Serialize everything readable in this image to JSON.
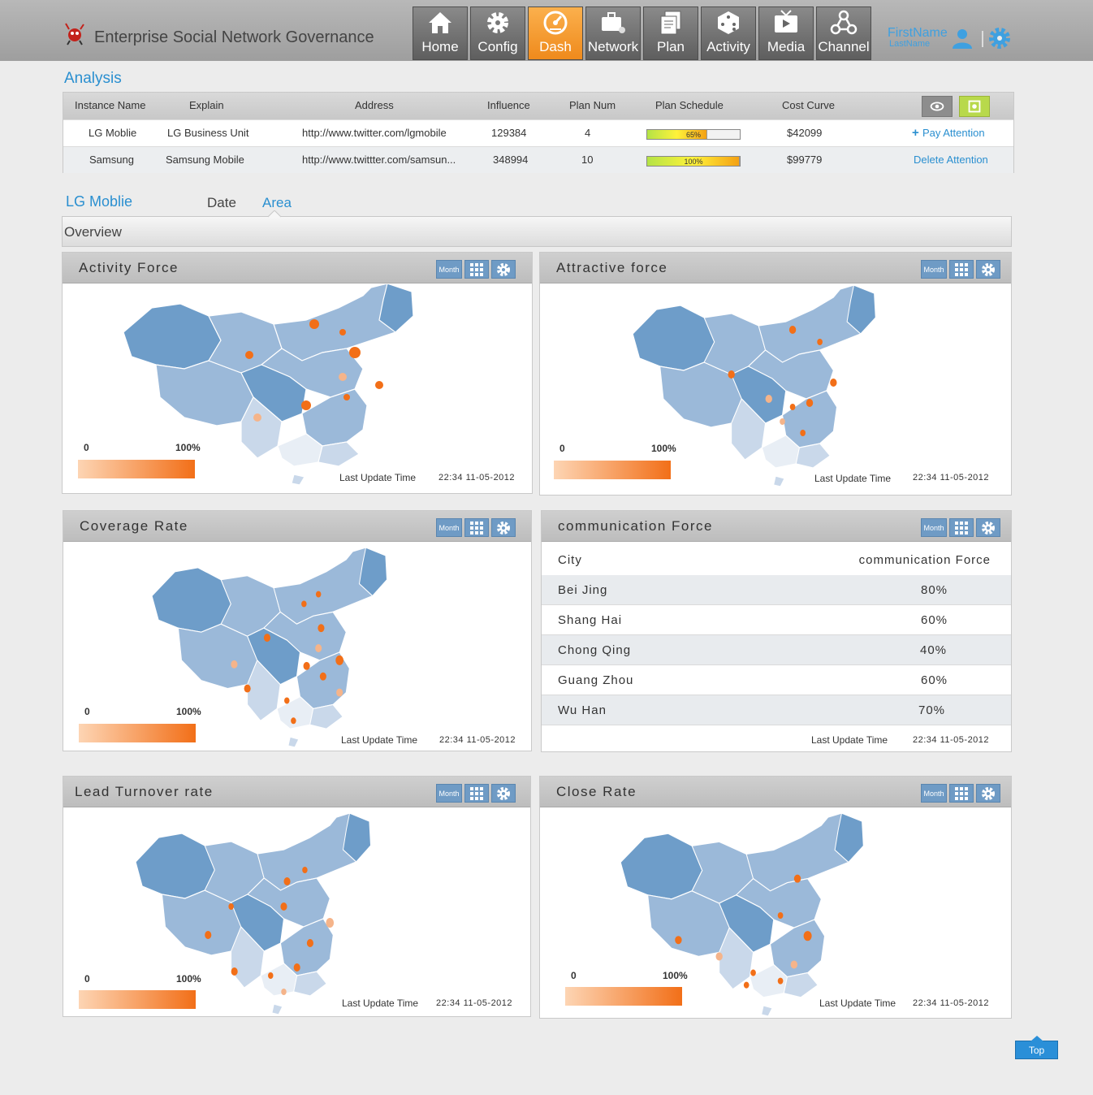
{
  "app": {
    "title": "Enterprise Social Network Governance"
  },
  "nav": [
    {
      "label": "Home",
      "icon": "home-icon",
      "active": false
    },
    {
      "label": "Config",
      "icon": "gear-icon",
      "active": false
    },
    {
      "label": "Dash",
      "icon": "dashboard-icon",
      "active": true
    },
    {
      "label": "Network",
      "icon": "briefcase-icon",
      "active": false
    },
    {
      "label": "Plan",
      "icon": "documents-icon",
      "active": false
    },
    {
      "label": "Activity",
      "icon": "dice-icon",
      "active": false
    },
    {
      "label": "Media",
      "icon": "tv-icon",
      "active": false
    },
    {
      "label": "Channel",
      "icon": "network-nodes-icon",
      "active": false
    }
  ],
  "user": {
    "first": "FirstName",
    "last": "LastName"
  },
  "analysis": {
    "title": "Analysis",
    "headers": [
      "Instance Name",
      "Explain",
      "Address",
      "Influence",
      "Plan Num",
      "Plan Schedule",
      "Cost Curve"
    ],
    "rows": [
      {
        "name": "LG Moblie",
        "explain": "LG Business Unit",
        "address": "http://www.twitter.com/lgmobile",
        "influence": "129384",
        "plan_num": "4",
        "schedule": 0.65,
        "schedule_label": "65%",
        "cost": "$42099",
        "action": "Pay Attention"
      },
      {
        "name": "Samsung",
        "explain": "Samsung Mobile",
        "address": "http://www.twittter.com/samsun...",
        "influence": "348994",
        "plan_num": "10",
        "schedule": 1.0,
        "schedule_label": "100%",
        "cost": "$99779",
        "action": "Delete Attention"
      }
    ]
  },
  "detail": {
    "instance": "LG  Moblie",
    "tabs": [
      "Date",
      "Area"
    ],
    "active_tab": "Area",
    "overview": "Overview"
  },
  "panels": {
    "month": "Month",
    "legend_min": "0",
    "legend_max": "100%",
    "update_label": "Last Update Time",
    "update_time": "22:34 11-05-2012",
    "activity": "Activity  Force",
    "attractive": "Attractive force",
    "coverage": "Coverage Rate",
    "communication": "communication Force",
    "lead": "Lead Turnover rate",
    "close": "Close Rate"
  },
  "communication": {
    "col_city": "City",
    "col_value": "communication Force",
    "rows": [
      {
        "city": "Bei Jing",
        "value": "80%"
      },
      {
        "city": "Shang Hai",
        "value": "60%"
      },
      {
        "city": "Chong Qing",
        "value": "40%"
      },
      {
        "city": "Guang Zhou",
        "value": "60%"
      },
      {
        "city": "Wu Han",
        "value": "70%"
      }
    ]
  },
  "top_button": "Top",
  "colors": {
    "accent": "#2a8fd0",
    "active_nav": "#f29a2e",
    "map_dark": "#6e9dc9",
    "map_mid": "#9bb9d9",
    "map_light": "#c9d8ea",
    "dot": "#f26f18"
  }
}
